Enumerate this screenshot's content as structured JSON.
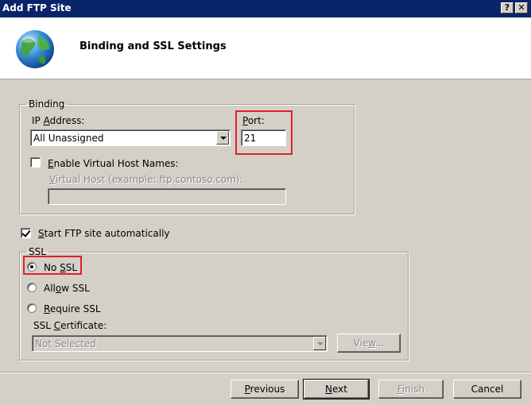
{
  "window": {
    "title": "Add FTP Site",
    "help_label": "?",
    "close_label": "✕"
  },
  "header": {
    "title": "Binding and SSL Settings",
    "icon": "globe-icon"
  },
  "binding": {
    "legend": "Binding",
    "ip_label": "IP Address:",
    "ip_value": "All Unassigned",
    "port_label": "Port:",
    "port_value": "21",
    "virtual_host_checkbox": "Enable Virtual Host Names:",
    "virtual_host_checked": false,
    "virtual_host_label": "Virtual Host (example: ftp.contoso.com):",
    "virtual_host_value": ""
  },
  "start_auto": {
    "label": "Start FTP site automatically",
    "checked": true
  },
  "ssl": {
    "legend": "SSL",
    "options": [
      "No SSL",
      "Allow SSL",
      "Require SSL"
    ],
    "selected": "No SSL",
    "cert_label": "SSL Certificate:",
    "cert_value": "Not Selected",
    "view_label": "View..."
  },
  "footer": {
    "previous": "Previous",
    "next": "Next",
    "finish": "Finish",
    "cancel": "Cancel"
  },
  "colors": {
    "titlebar": "#0a246a",
    "highlight": "#e0202a",
    "face": "#d4d0c8"
  }
}
